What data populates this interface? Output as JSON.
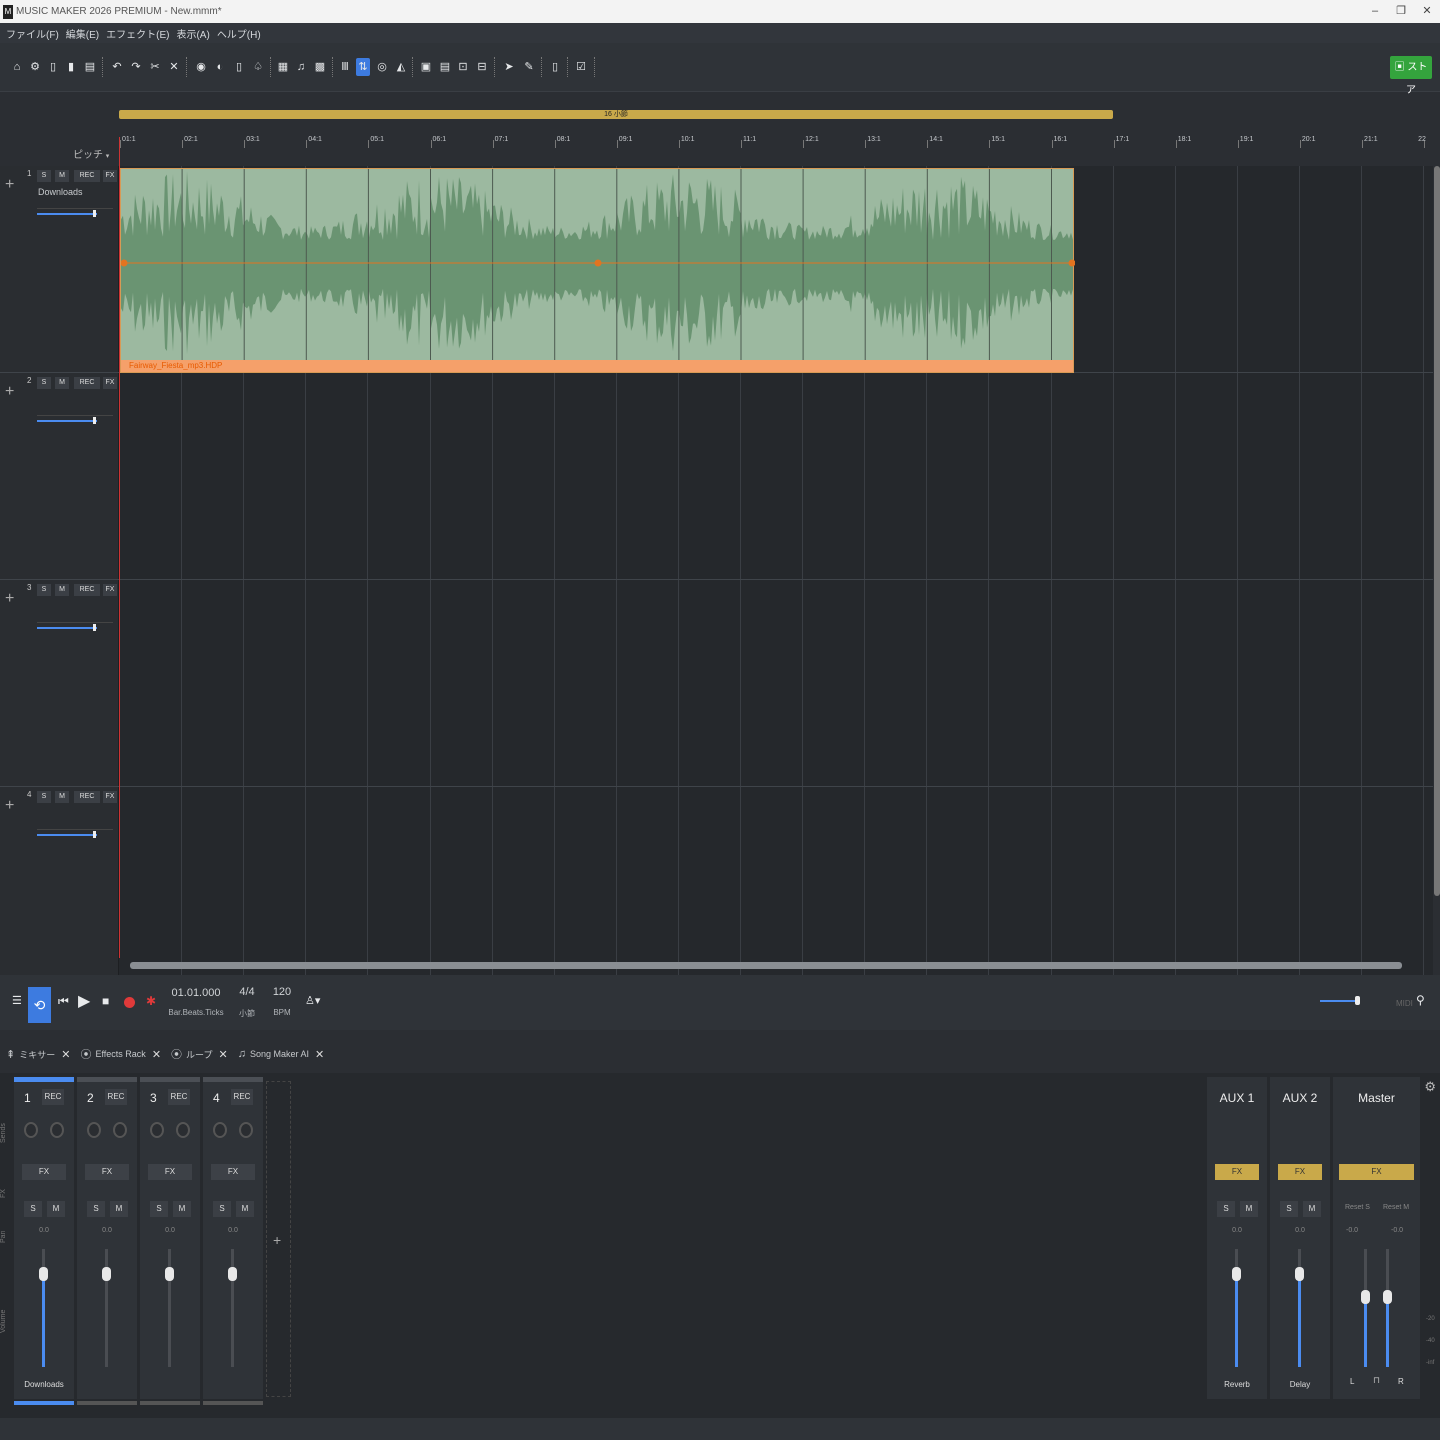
{
  "window": {
    "title": "MUSIC MAKER 2026 PREMIUM - New.mmm*",
    "app_icon": "M"
  },
  "menu": [
    "ファイル(F)",
    "編集(E)",
    "エフェクト(E)",
    "表示(A)",
    "ヘルプ(H)"
  ],
  "store_button": "ストア",
  "range_label": "16 小節",
  "ruler": {
    "ticks": [
      "01:1",
      "02:1",
      "03:1",
      "04:1",
      "05:1",
      "06:1",
      "07:1",
      "08:1",
      "09:1",
      "10:1",
      "11:1",
      "12:1",
      "13:1",
      "14:1",
      "15:1",
      "16:1",
      "17:1",
      "18:1",
      "19:1",
      "20:1",
      "21:1",
      "22"
    ],
    "pitch_label": "ピッチ"
  },
  "tracks": [
    {
      "num": "1",
      "name": "Downloads",
      "solo": "S",
      "mute": "M",
      "rec": "REC",
      "fx": "FX"
    },
    {
      "num": "2",
      "name": "",
      "solo": "S",
      "mute": "M",
      "rec": "REC",
      "fx": "FX"
    },
    {
      "num": "3",
      "name": "",
      "solo": "S",
      "mute": "M",
      "rec": "REC",
      "fx": "FX"
    },
    {
      "num": "4",
      "name": "",
      "solo": "S",
      "mute": "M",
      "rec": "REC",
      "fx": "FX"
    }
  ],
  "clip": {
    "name": "Fairway_Fiesta_mp3.HDP",
    "color": "#9cb9a0"
  },
  "transport": {
    "position": "01.01.000",
    "position_label": "Bar.Beats.Ticks",
    "signature": "4/4",
    "signature_label": "小節",
    "bpm": "120",
    "bpm_label": "BPM",
    "midi_label": "MIDI"
  },
  "tabs": [
    {
      "label": "ミキサー",
      "icon": "mixer-icon"
    },
    {
      "label": "Effects Rack",
      "icon": "effects-icon"
    },
    {
      "label": "ループ",
      "icon": "loop-icon"
    },
    {
      "label": "Song Maker AI",
      "icon": "note-icon"
    }
  ],
  "mixer": {
    "channels": [
      {
        "num": "1",
        "rec": "REC",
        "fx": "FX",
        "s": "S",
        "m": "M",
        "db": "0.0",
        "name": "Downloads"
      },
      {
        "num": "2",
        "rec": "REC",
        "fx": "FX",
        "s": "S",
        "m": "M",
        "db": "0.0",
        "name": ""
      },
      {
        "num": "3",
        "rec": "REC",
        "fx": "FX",
        "s": "S",
        "m": "M",
        "db": "0.0",
        "name": ""
      },
      {
        "num": "4",
        "rec": "REC",
        "fx": "FX",
        "s": "S",
        "m": "M",
        "db": "0.0",
        "name": ""
      }
    ],
    "aux": [
      {
        "title": "AUX 1",
        "fx": "FX",
        "s": "S",
        "m": "M",
        "db": "0.0",
        "name": "Reverb"
      },
      {
        "title": "AUX 2",
        "fx": "FX",
        "s": "S",
        "m": "M",
        "db": "0.0",
        "name": "Delay"
      }
    ],
    "master": {
      "title": "Master",
      "fx": "FX",
      "reset_s": "Reset S",
      "reset_m": "Reset M",
      "db_l": "-0.0",
      "db_r": "-0.0",
      "l": "L",
      "r": "R"
    },
    "side_labels": [
      "Sends",
      "FX",
      "Pan",
      "Volume"
    ],
    "meter_labels": [
      "-20",
      "-40",
      "-inf"
    ]
  },
  "colors": {
    "accent": "#3d7be0",
    "clip_border": "#d89a55",
    "aux_fx": "#c9a94a",
    "store": "#34a43d"
  }
}
